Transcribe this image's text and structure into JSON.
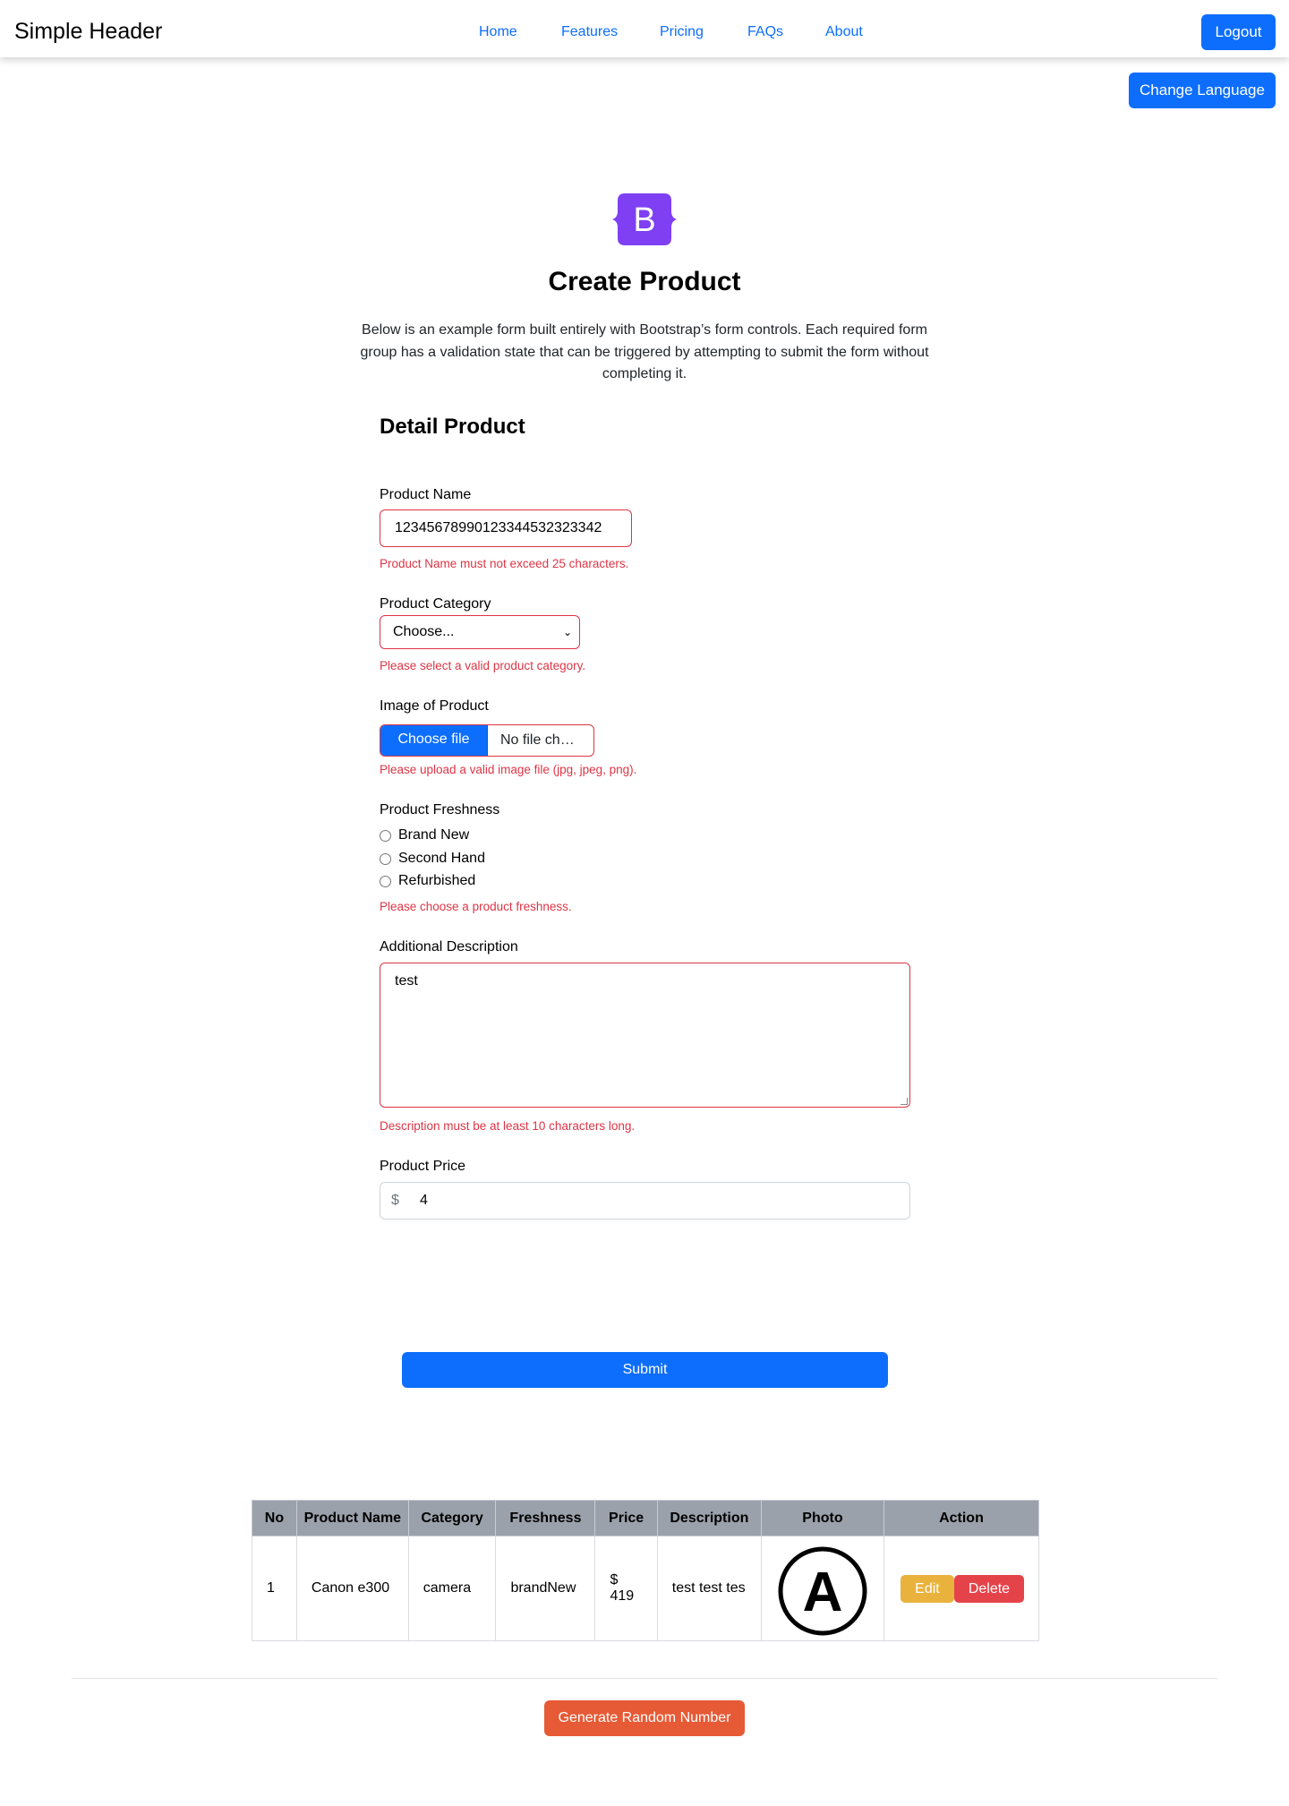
{
  "header": {
    "brand": "Simple Header",
    "nav": [
      "Home",
      "Features",
      "Pricing",
      "FAQs",
      "About"
    ],
    "logout_label": "Logout",
    "change_language_label": "Change Language"
  },
  "hero": {
    "logo_letter": "B",
    "title": "Create Product",
    "lead": "Below is an example form built entirely with Bootstrap’s form controls. Each required form group has a validation state that can be triggered by attempting to submit the form without completing it."
  },
  "form": {
    "section_title": "Detail Product",
    "product_name": {
      "label": "Product Name",
      "value": "1234567899012334453232334​2",
      "error": "Product Name must not exceed 25 characters."
    },
    "category": {
      "label": "Product Category",
      "selected": "Choose...",
      "error": "Please select a valid product category."
    },
    "image": {
      "label": "Image of Product",
      "button": "Choose file",
      "filename": "No file ch…",
      "error": "Please upload a valid image file (jpg, jpeg, png)."
    },
    "freshness": {
      "label": "Product Freshness",
      "options": [
        "Brand New",
        "Second Hand",
        "Refurbished"
      ],
      "error": "Please choose a product freshness."
    },
    "description": {
      "label": "Additional Description",
      "value": "test",
      "error": "Description must be at least 10 characters long."
    },
    "price": {
      "label": "Product Price",
      "prefix": "$",
      "value": "4"
    },
    "submit_label": "Submit"
  },
  "table": {
    "headers": [
      "No",
      "Product Name",
      "Category",
      "Freshness",
      "Price",
      "Description",
      "Photo",
      "Action"
    ],
    "rows": [
      {
        "no": "1",
        "name": "Canon e300",
        "category": "camera",
        "freshness": "brandNew",
        "price": "$ 419",
        "description": "test test tes",
        "photo_letter": "A",
        "edit_label": "Edit",
        "delete_label": "Delete"
      }
    ]
  },
  "footer": {
    "random_button": "Generate Random Number"
  },
  "colors": {
    "primary": "#0d6efd",
    "danger": "#dc3545",
    "warning": "#e9b23c",
    "logo_purple": "#7f3ff2",
    "random_button": "#e65a35",
    "table_header": "#9ba1ab"
  }
}
